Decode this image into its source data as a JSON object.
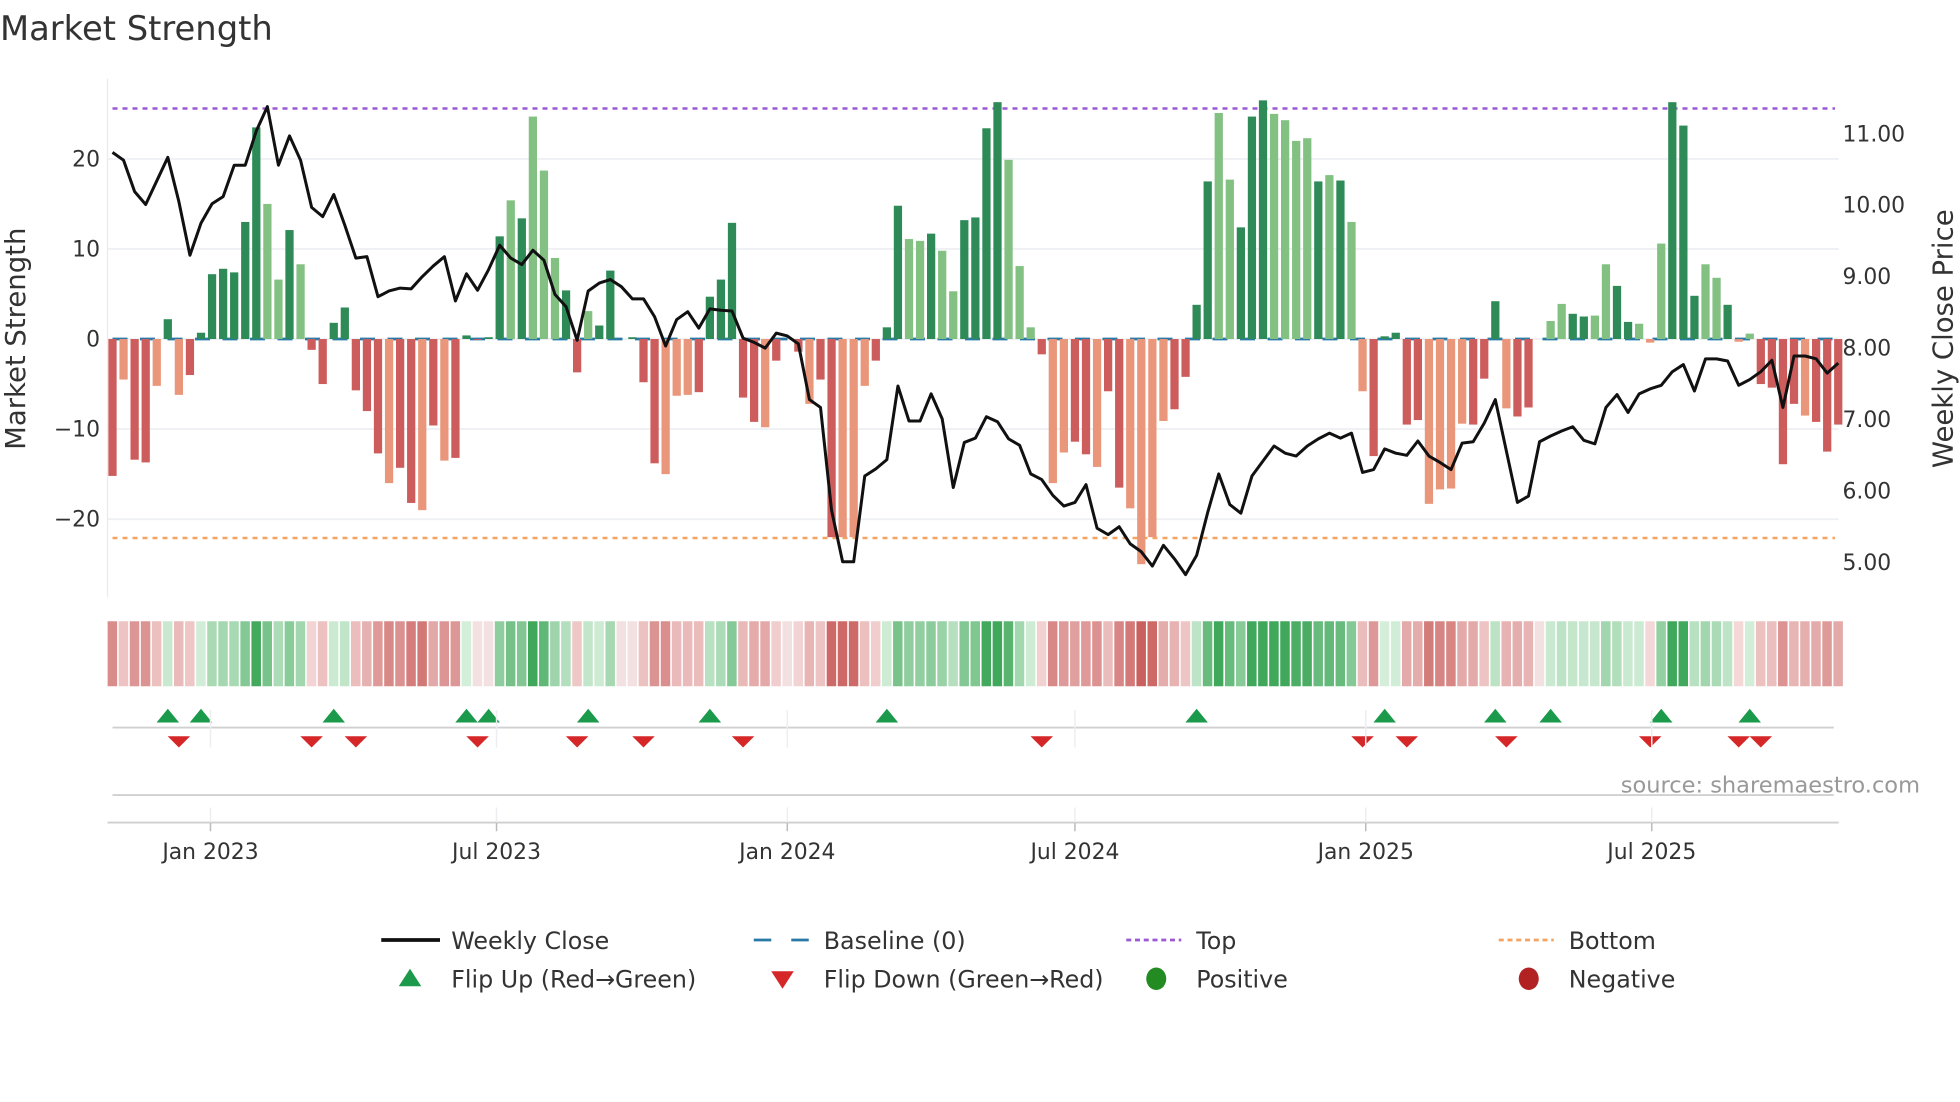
{
  "chart_data": {
    "type": "bar",
    "title": "Market Strength",
    "ylabel": "Market Strength",
    "y2label": "Weekly Close Price",
    "ylim": [
      -28.7,
      28.9
    ],
    "y2lim": [
      4.51,
      11.77
    ],
    "yticks": [
      {
        "v": 20,
        "label": "20"
      },
      {
        "v": 10,
        "label": "10"
      },
      {
        "v": 0,
        "label": "0"
      },
      {
        "v": -10,
        "label": "−10"
      },
      {
        "v": -20,
        "label": "−20"
      }
    ],
    "y2ticks": [
      {
        "v": 11,
        "label": "11.00"
      },
      {
        "v": 10,
        "label": "10.00"
      },
      {
        "v": 9,
        "label": "9.00"
      },
      {
        "v": 8,
        "label": "8.00"
      },
      {
        "v": 7,
        "label": "7.00"
      },
      {
        "v": 6,
        "label": "6.00"
      },
      {
        "v": 5,
        "label": "5.00"
      }
    ],
    "xticks": [
      {
        "date": "2023-01-01",
        "label": "Jan 2023"
      },
      {
        "date": "2023-07-01",
        "label": "Jul 2023"
      },
      {
        "date": "2024-01-01",
        "label": "Jan 2024"
      },
      {
        "date": "2024-07-01",
        "label": "Jul 2024"
      },
      {
        "date": "2025-01-01",
        "label": "Jan 2025"
      },
      {
        "date": "2025-07-01",
        "label": "Jul 2025"
      }
    ],
    "start_date": "2022-10-31",
    "interval_days": 7,
    "top_level": 25.6,
    "bottom_level": -22.1,
    "grid": true,
    "legend_placement": "bottom",
    "source": "source: sharemaestro.com",
    "colors": {
      "pos_strong": "#2e8b57",
      "pos_weak": "#82c182",
      "neg_strong": "#cd5c5c",
      "neg_weak": "#e9967a",
      "close": "#111111",
      "baseline": "#2a7aa8",
      "top": "#9b59d6",
      "bottom": "#f4a460",
      "flip_up": "#1a9a4a",
      "flip_down": "#d62728",
      "positive": "#228b22",
      "negative": "#b22222"
    },
    "strength": [
      -15.2,
      -4.5,
      -13.4,
      -13.7,
      -5.2,
      2.2,
      -6.2,
      -4.0,
      0.7,
      7.2,
      7.8,
      7.4,
      13.0,
      23.5,
      15.0,
      6.6,
      12.1,
      8.3,
      -1.2,
      -5.0,
      1.8,
      3.5,
      -5.7,
      -8.0,
      -12.7,
      -16.0,
      -14.3,
      -18.2,
      -19.0,
      -9.6,
      -13.5,
      -13.2,
      0.4,
      -0.1,
      0.2,
      11.4,
      15.4,
      13.4,
      24.7,
      18.7,
      9.0,
      5.4,
      -3.7,
      3.1,
      1.5,
      7.6,
      0,
      0.2,
      -4.8,
      -13.8,
      -15.0,
      -6.3,
      -6.2,
      -5.9,
      4.7,
      6.6,
      12.9,
      -6.5,
      -9.2,
      -9.8,
      -2.4,
      0,
      -1.4,
      -7.2,
      -4.5,
      -22.0,
      -22.0,
      -22.0,
      -5.2,
      -2.4,
      1.3,
      14.8,
      11.1,
      10.9,
      11.7,
      9.8,
      5.3,
      13.2,
      13.5,
      23.4,
      26.3,
      19.9,
      8.1,
      1.3,
      -1.7,
      -16.0,
      -12.6,
      -11.4,
      -12.8,
      -14.2,
      -5.8,
      -16.5,
      -18.8,
      -25.0,
      -22.0,
      -9.1,
      -7.8,
      -4.2,
      3.8,
      17.5,
      25.1,
      17.7,
      12.4,
      24.7,
      26.5,
      25.0,
      24.3,
      22.0,
      22.3,
      17.5,
      18.2,
      17.6,
      13.0,
      -5.8,
      -13.0,
      0.3,
      0.7,
      -9.5,
      -9.0,
      -18.3,
      -16.7,
      -16.6,
      -9.4,
      -9.5,
      -4.4,
      4.2,
      -7.7,
      -8.6,
      -7.6,
      0,
      2.0,
      3.9,
      2.8,
      2.5,
      2.6,
      8.3,
      5.9,
      1.9,
      1.7,
      -0.4,
      10.6,
      26.3,
      23.7,
      4.8,
      8.3,
      6.8,
      3.8,
      -0.3,
      0.6,
      -5.0,
      -5.4,
      -13.9,
      -7.2,
      -8.5,
      -9.2,
      -12.5,
      -9.5
    ],
    "shade": "dlddldldddddddlldldddddddlddldldddddldlllddlddddddlllddddddldddlddllldddlldllddddllldllddlddllllddddlldddlllldldlldddddlllldddldddllddllddllldddlldllddddlddddl",
    "weekly_close": [
      10.74,
      10.63,
      10.19,
      10.01,
      10.34,
      10.67,
      10.05,
      9.3,
      9.75,
      10.02,
      10.12,
      10.56,
      10.56,
      11.04,
      11.38,
      10.56,
      10.97,
      10.63,
      9.97,
      9.84,
      10.15,
      9.72,
      9.26,
      9.28,
      8.72,
      8.8,
      8.84,
      8.83,
      9.0,
      9.15,
      9.28,
      8.66,
      9.04,
      8.81,
      9.1,
      9.44,
      9.26,
      9.17,
      9.37,
      9.23,
      8.75,
      8.58,
      8.11,
      8.8,
      8.91,
      8.96,
      8.86,
      8.69,
      8.69,
      8.44,
      8.03,
      8.4,
      8.51,
      8.28,
      8.55,
      8.53,
      8.52,
      8.14,
      8.08,
      8.0,
      8.21,
      8.17,
      8.06,
      7.28,
      7.17,
      5.73,
      5.01,
      5.01,
      6.21,
      6.31,
      6.44,
      7.47,
      6.98,
      6.98,
      7.36,
      7.01,
      6.05,
      6.68,
      6.74,
      7.04,
      6.97,
      6.73,
      6.64,
      6.24,
      6.16,
      5.94,
      5.79,
      5.84,
      6.09,
      5.48,
      5.39,
      5.5,
      5.26,
      5.15,
      4.95,
      5.24,
      5.05,
      4.83,
      5.1,
      5.7,
      6.24,
      5.81,
      5.69,
      6.21,
      6.42,
      6.63,
      6.53,
      6.49,
      6.63,
      6.73,
      6.81,
      6.74,
      6.81,
      6.26,
      6.3,
      6.59,
      6.53,
      6.5,
      6.7,
      6.49,
      6.4,
      6.3,
      6.67,
      6.69,
      6.95,
      7.28,
      6.56,
      5.84,
      5.93,
      6.69,
      6.77,
      6.84,
      6.9,
      6.71,
      6.66,
      7.17,
      7.35,
      7.1,
      7.36,
      7.43,
      7.48,
      7.67,
      7.77,
      7.4,
      7.85,
      7.85,
      7.82,
      7.48,
      7.56,
      7.67,
      7.83,
      7.17,
      7.89,
      7.89,
      7.85,
      7.65,
      7.79
    ],
    "flip_up_weeks": [
      6,
      9,
      21,
      33,
      35,
      44,
      55,
      71,
      99,
      116,
      126,
      131,
      141,
      149
    ],
    "flip_down_weeks": [
      7,
      19,
      23,
      34,
      43,
      49,
      58,
      85,
      114,
      118,
      127,
      140,
      148,
      150
    ],
    "legend": [
      {
        "key": "close",
        "label": "Weekly Close"
      },
      {
        "key": "baseline",
        "label": "Baseline (0)"
      },
      {
        "key": "top",
        "label": "Top"
      },
      {
        "key": "bottom",
        "label": "Bottom"
      },
      {
        "key": "flip_up",
        "label": "Flip Up (Red→Green)"
      },
      {
        "key": "flip_down",
        "label": "Flip Down (Green→Red)"
      },
      {
        "key": "positive",
        "label": "Positive"
      },
      {
        "key": "negative",
        "label": "Negative"
      }
    ]
  }
}
